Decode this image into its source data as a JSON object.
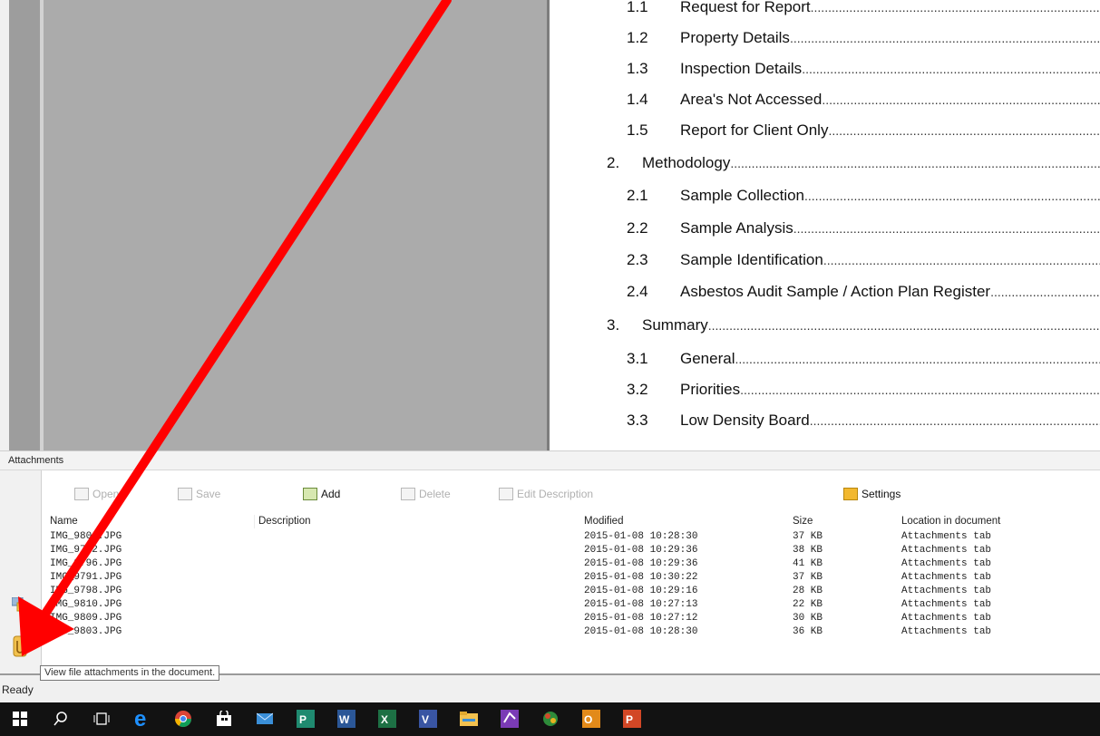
{
  "toc": {
    "entries": [
      {
        "num": "1.1",
        "title": "Request for Report"
      },
      {
        "num": "1.2",
        "title": "Property Details"
      },
      {
        "num": "1.3",
        "title": "Inspection Details"
      },
      {
        "num": "1.4",
        "title": "Area's Not Accessed"
      },
      {
        "num": "1.5",
        "title": "Report for Client Only"
      },
      {
        "num": "2.",
        "title": "Methodology"
      },
      {
        "num": "2.1",
        "title": "Sample Collection"
      },
      {
        "num": "2.2",
        "title": "Sample Analysis"
      },
      {
        "num": "2.3",
        "title": "Sample Identification"
      },
      {
        "num": "2.4",
        "title": "Asbestos Audit Sample / Action Plan Register"
      },
      {
        "num": "3.",
        "title": "Summary"
      },
      {
        "num": "3.1",
        "title": "General"
      },
      {
        "num": "3.2",
        "title": "Priorities"
      },
      {
        "num": "3.3",
        "title": "Low Density Board"
      }
    ]
  },
  "attachments": {
    "panel_title": "Attachments",
    "toolbar": {
      "open": "Open",
      "save": "Save",
      "add": "Add",
      "delete": "Delete",
      "edit_description": "Edit Description",
      "settings": "Settings"
    },
    "columns": {
      "name": "Name",
      "description": "Description",
      "modified": "Modified",
      "size": "Size",
      "location": "Location in document"
    },
    "rows": [
      {
        "name": "IMG_9806.JPG",
        "description": "",
        "modified": "2015-01-08 10:28:30",
        "size": "37 KB",
        "location": "Attachments tab"
      },
      {
        "name": "IMG_9792.JPG",
        "description": "",
        "modified": "2015-01-08 10:29:36",
        "size": "38 KB",
        "location": "Attachments tab"
      },
      {
        "name": "IMG_9796.JPG",
        "description": "",
        "modified": "2015-01-08 10:29:36",
        "size": "41 KB",
        "location": "Attachments tab"
      },
      {
        "name": "IMG_9791.JPG",
        "description": "",
        "modified": "2015-01-08 10:30:22",
        "size": "37 KB",
        "location": "Attachments tab"
      },
      {
        "name": "IMG_9798.JPG",
        "description": "",
        "modified": "2015-01-08 10:29:16",
        "size": "28 KB",
        "location": "Attachments tab"
      },
      {
        "name": "IMG_9810.JPG",
        "description": "",
        "modified": "2015-01-08 10:27:13",
        "size": "22 KB",
        "location": "Attachments tab"
      },
      {
        "name": "IMG_9809.JPG",
        "description": "",
        "modified": "2015-01-08 10:27:12",
        "size": "30 KB",
        "location": "Attachments tab"
      },
      {
        "name": "IMG_9803.JPG",
        "description": "",
        "modified": "2015-01-08 10:28:30",
        "size": "36 KB",
        "location": "Attachments tab"
      }
    ],
    "tooltip": "View file attachments in the document."
  },
  "status": {
    "text": "Ready"
  },
  "colors": {
    "arrow": "#ff0000",
    "taskbar": "#121212",
    "edge_blue": "#1e90ff",
    "settings_icon": "#f2b82f"
  },
  "taskbar_icons": [
    "windows-start-icon",
    "search-icon",
    "task-view-icon",
    "edge-browser-icon",
    "chrome-icon",
    "store-icon",
    "mail-icon",
    "publisher-icon",
    "word-icon",
    "excel-icon",
    "visio-icon",
    "file-explorer-icon",
    "onenote-icon",
    "app-icon",
    "outlook-icon",
    "powerpoint-icon"
  ]
}
